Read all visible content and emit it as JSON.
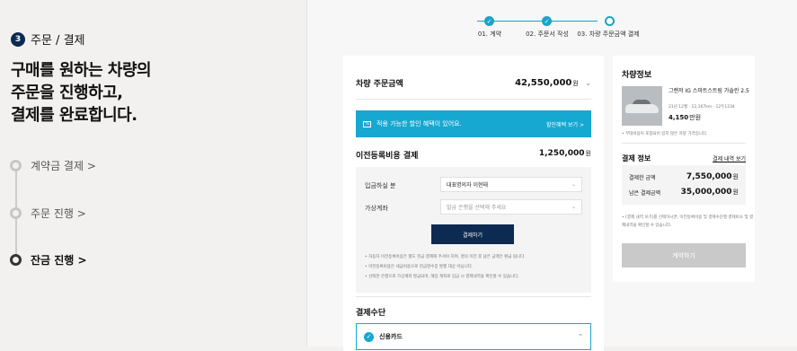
{
  "left": {
    "step_number": "3",
    "step_label": "주문 / 결제",
    "headline": [
      "구매를 원하는 차량의",
      "주문을 진행하고,",
      "결제를 완료합니다."
    ],
    "steps": [
      {
        "label": "계약금 결제 >",
        "active": false
      },
      {
        "label": "주문 진행 >",
        "active": false
      },
      {
        "label": "잔금 진행 >",
        "active": true
      }
    ]
  },
  "tracker": {
    "steps": [
      "01. 계약",
      "02. 주문서 작성",
      "03. 차량 주문금액 결제"
    ]
  },
  "main": {
    "order_amount_label": "차량 주문금액",
    "order_amount_value": "42,550,000",
    "currency": "원",
    "banner_text": "적용 가능한 할인 혜택이 있어요.",
    "banner_link": "할인혜택 보기 >",
    "reg_label": "이전등록비용 결제",
    "reg_value": "1,250,000",
    "payer_label": "입금하실 분",
    "payer_value": "대표명의자 이현태",
    "account_label": "가상계좌",
    "account_placeholder": "발급 은행을 선택해 주세요",
    "pay_button": "결제하기",
    "notes": [
      "자동차 이전등록비용은 별도 현금 결제해 주셔야 하며, 명의 이전 후 남은 금액은 환급 됩니다.",
      "이전등록비용은 세금비용으로 현금영수증 발행 대상 아닙니다.",
      "선택한 은행으로 가상계좌 발급되며, 해당 계좌로 입금 시 결제내역을 확인할 수 있습니다."
    ],
    "method_title": "결제수단",
    "method_selected": "신용카드"
  },
  "side": {
    "vehicle_title": "차량정보",
    "car_name": "그랜저 IG 스마트스트림 가솔린 2.5",
    "car_meta": "21년 12월 · 12,167km · 12두1234",
    "car_price": "4,150",
    "car_price_unit": "만원",
    "vehicle_note": "• 부대비용이 포함되어 있지 않은 차량 가격입니다.",
    "pay_info_title": "결제 정보",
    "pay_info_link": "결제 내역 보기",
    "paid_label": "결제한 금액",
    "paid_value": "7,550,000",
    "remaining_label": "남은 결제금액",
    "remaining_value": "35,000,000",
    "currency": "원",
    "pay_note": "• [결제 내역 보기]를 선택하시면, 이전등록비용 및 결제수단별 결제비소 및 결제내역을 확인할 수 있습니다.",
    "contract_button": "계약하기"
  },
  "colors": {
    "accent": "#16a8d1",
    "navy": "#0d2a52",
    "disabled": "#c9c9c9"
  }
}
